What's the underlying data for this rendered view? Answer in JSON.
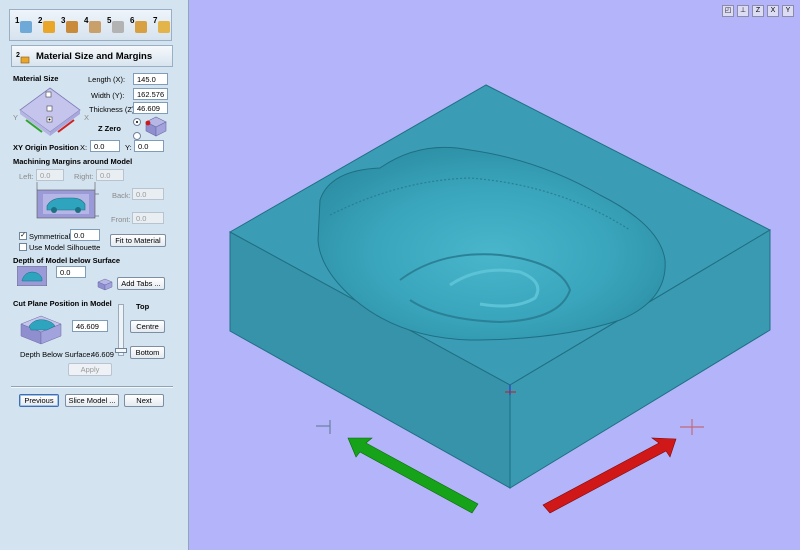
{
  "toolbar": {
    "steps": [
      {
        "num": "1",
        "icon": "import-model-icon"
      },
      {
        "num": "2",
        "icon": "material-size-icon"
      },
      {
        "num": "3",
        "icon": "roughing-icon"
      },
      {
        "num": "4",
        "icon": "finishing-icon"
      },
      {
        "num": "5",
        "icon": "cutouts-icon"
      },
      {
        "num": "6",
        "icon": "preview-icon"
      },
      {
        "num": "7",
        "icon": "save-toolpath-icon"
      }
    ]
  },
  "header": {
    "step_num": "2",
    "title": "Material Size and Margins"
  },
  "material": {
    "section_title": "Material Size",
    "length_label": "Length (X):",
    "length_value": "145.0",
    "width_label": "Width (Y):",
    "width_value": "162.576",
    "thickness_label": "Thickness (Z):",
    "thickness_value": "46.609",
    "zzero_label": "Z Zero",
    "axis_x": "X",
    "axis_y": "Y"
  },
  "xy_origin": {
    "label": "XY Origin Position",
    "x_label": "X:",
    "x_value": "0.0",
    "y_label": "Y:",
    "y_value": "0.0"
  },
  "margins": {
    "title": "Machining Margins around Model",
    "left_label": "Left:",
    "left_value": "0.0",
    "right_label": "Right:",
    "right_value": "0.0",
    "back_label": "Back:",
    "back_value": "0.0",
    "front_label": "Front:",
    "front_value": "0.0",
    "symmetrical_label": "Symmetrical",
    "symmetrical_checked": true,
    "symmetrical_value": "0.0",
    "silhouette_label": "Use Model Silhouette",
    "silhouette_checked": false,
    "fit_button": "Fit to Material"
  },
  "depth": {
    "title": "Depth of Model below Surface",
    "value": "0.0",
    "add_tabs_button": "Add Tabs ..."
  },
  "cut_plane": {
    "title": "Cut Plane Position in Model",
    "value": "46.609",
    "top_label": "Top",
    "centre_button": "Centre",
    "bottom_button": "Bottom",
    "depth_below_label": "Depth Below Surface:",
    "depth_below_value": "46.609",
    "apply_button": "Apply"
  },
  "nav": {
    "previous": "Previous",
    "slice": "Slice Model ...",
    "next": "Next"
  },
  "view_toolbar": {
    "buttons": [
      {
        "name": "iso-view",
        "glyph": "◰"
      },
      {
        "name": "plan-view",
        "glyph": "⊥"
      },
      {
        "name": "z-view",
        "glyph": "Z"
      },
      {
        "name": "x-view",
        "glyph": "X"
      },
      {
        "name": "y-view",
        "glyph": "Y"
      }
    ]
  },
  "colors": {
    "viewport_bg": "#b4b4fa",
    "material": "#2e8fa4",
    "x_arrow": "#d11818",
    "y_arrow": "#17a319",
    "panel_bg": "#d4e3f0"
  }
}
